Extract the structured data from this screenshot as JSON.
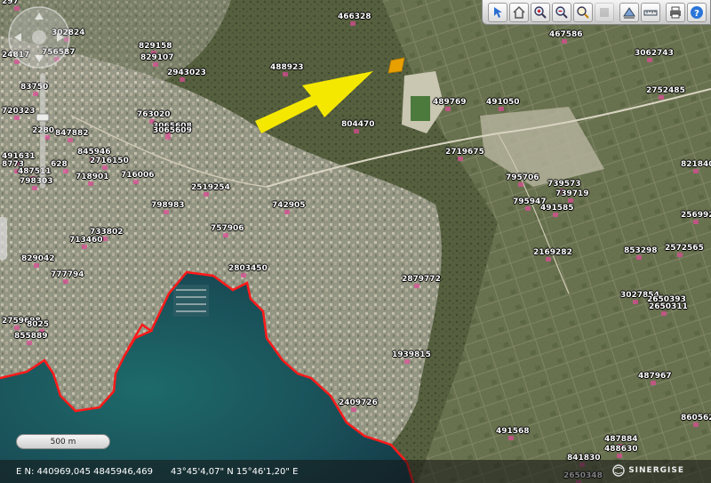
{
  "parcels": [
    {
      "label": "297"
    },
    {
      "label": "466328"
    },
    {
      "label": "467586"
    },
    {
      "label": "302824"
    },
    {
      "label": "756587"
    },
    {
      "label": "24817"
    },
    {
      "label": "829158"
    },
    {
      "label": "829107"
    },
    {
      "label": "2943023"
    },
    {
      "label": "488923"
    },
    {
      "label": "3062743"
    },
    {
      "label": "83750"
    },
    {
      "label": "2752485"
    },
    {
      "label": "489769"
    },
    {
      "label": "491050"
    },
    {
      "label": "720323"
    },
    {
      "label": "763020"
    },
    {
      "label": "2280"
    },
    {
      "label": "3065608"
    },
    {
      "label": "3065609"
    },
    {
      "label": "804470"
    },
    {
      "label": "847882"
    },
    {
      "label": "845946"
    },
    {
      "label": "2716150"
    },
    {
      "label": "2719675"
    },
    {
      "label": "491631"
    },
    {
      "label": "8773"
    },
    {
      "label": "487511"
    },
    {
      "label": "628"
    },
    {
      "label": "798303"
    },
    {
      "label": "718901"
    },
    {
      "label": "716006"
    },
    {
      "label": "821840"
    },
    {
      "label": "795706"
    },
    {
      "label": "739573"
    },
    {
      "label": "2519254"
    },
    {
      "label": "739719"
    },
    {
      "label": "798983"
    },
    {
      "label": "742905"
    },
    {
      "label": "2569925"
    },
    {
      "label": "795947"
    },
    {
      "label": "491585"
    },
    {
      "label": "733802"
    },
    {
      "label": "713460"
    },
    {
      "label": "757906"
    },
    {
      "label": "2169282"
    },
    {
      "label": "853298"
    },
    {
      "label": "2572565"
    },
    {
      "label": "829042"
    },
    {
      "label": "777794"
    },
    {
      "label": "2803450"
    },
    {
      "label": "2879772"
    },
    {
      "label": "3027854"
    },
    {
      "label": "2650393"
    },
    {
      "label": "2650311"
    },
    {
      "label": "2759698"
    },
    {
      "label": "8025"
    },
    {
      "label": "855889"
    },
    {
      "label": "1939815"
    },
    {
      "label": "487967"
    },
    {
      "label": "2409726"
    },
    {
      "label": "860562"
    },
    {
      "label": "491568"
    },
    {
      "label": "487884"
    },
    {
      "label": "488630"
    },
    {
      "label": "841830"
    },
    {
      "label": "2650348"
    }
  ],
  "scale": {
    "label": "500 m"
  },
  "status": {
    "projected": "E N: 440969,045 4845946,469",
    "geographic": "43°45'4,07\" N 15°46'1,20\" E",
    "brand": "SINERGISE"
  },
  "toolbar": {
    "buttons": [
      {
        "icon": "identify-icon"
      },
      {
        "icon": "home-extent-icon"
      },
      {
        "icon": "zoom-in-icon"
      },
      {
        "icon": "zoom-out-icon"
      },
      {
        "icon": "pan-icon"
      },
      {
        "icon": "disabled-tool-icon"
      },
      {
        "icon": "measure-area-icon"
      },
      {
        "icon": "measure-distance-icon"
      },
      {
        "icon": "print-icon"
      },
      {
        "icon": "help-icon"
      }
    ]
  },
  "colors": {
    "boundary": "#ff1a1a",
    "arrow": "#f5e800",
    "parcel": "#e8a000",
    "label_text": "#ffffff"
  }
}
